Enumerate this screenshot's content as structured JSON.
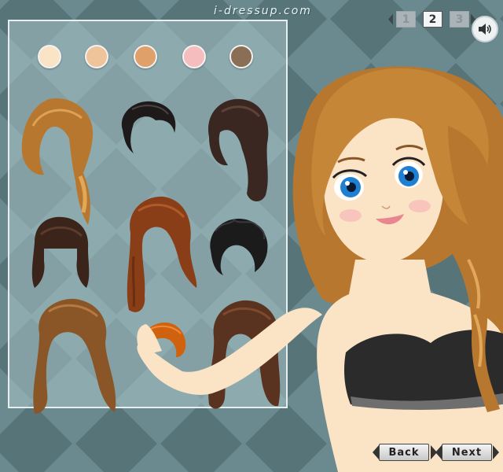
{
  "site": {
    "logo_text": "i-dressup.com"
  },
  "pager": {
    "pages": [
      "1",
      "2",
      "3"
    ],
    "current": "2"
  },
  "sound": {
    "icon": "speaker-icon"
  },
  "skin_tones": [
    "#fbe3c6",
    "#f0c49a",
    "#e0a06a",
    "#f6bdbf",
    "#8a6e55"
  ],
  "hairstyles": [
    {
      "name": "long-blonde-braid",
      "color": "#b8772f"
    },
    {
      "name": "short-black-updo",
      "color": "#1e1a1a"
    },
    {
      "name": "long-dark-wavy",
      "color": "#3a2722"
    },
    {
      "name": "dark-brown-bob-bangs",
      "color": "#3b241a"
    },
    {
      "name": "long-auburn-straight",
      "color": "#8a3e17"
    },
    {
      "name": "black-messy-short",
      "color": "#1b1b1b"
    },
    {
      "name": "long-brown-wavy",
      "color": "#8a5628"
    },
    {
      "name": "short-orange-crop",
      "color": "#d0620f"
    },
    {
      "name": "long-brown-curly",
      "color": "#5a3320"
    }
  ],
  "navigation": {
    "back_label": "Back",
    "next_label": "Next"
  }
}
